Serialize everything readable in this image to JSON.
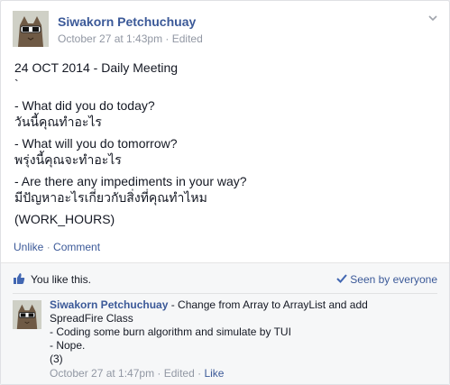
{
  "post": {
    "author": "Siwakorn Petchuchuay",
    "timestamp": "October 27 at 1:43pm",
    "separator": " · ",
    "edited": "Edited",
    "menu_icon": "chevron-down-icon",
    "lines": [
      "24 OCT 2014 - Daily Meeting\n`",
      "- What did you do today?\nวันนี้คุณทำอะไร",
      "- What will you do tomorrow?\nพรุ่งนี้คุณจะทำอะไร",
      "- Are there any impediments in your way?\nมีปัญหาอะไรเกี่ยวกับสิ่งที่คุณทำไหม",
      "(WORK_HOURS)"
    ]
  },
  "actions": {
    "unlike": "Unlike",
    "separator": " · ",
    "comment": "Comment"
  },
  "feedback": {
    "like_icon": "thumbs-up-icon",
    "you_like": "You like this.",
    "seen_icon": "check-icon",
    "seen": "Seen by everyone"
  },
  "comment": {
    "author": "Siwakorn Petchuchuay",
    "text_first": " - Change from Array to ArrayList and add",
    "lines": [
      "SpreadFire Class",
      "- Coding some burn algorithm and simulate by TUI",
      "- Nope.",
      "(3)"
    ],
    "timestamp": "October 27 at 1:47pm",
    "separator": " · ",
    "edited": "Edited",
    "like": "Like"
  },
  "colors": {
    "link": "#3b5998",
    "meta": "#9197a3",
    "text": "#141823"
  }
}
